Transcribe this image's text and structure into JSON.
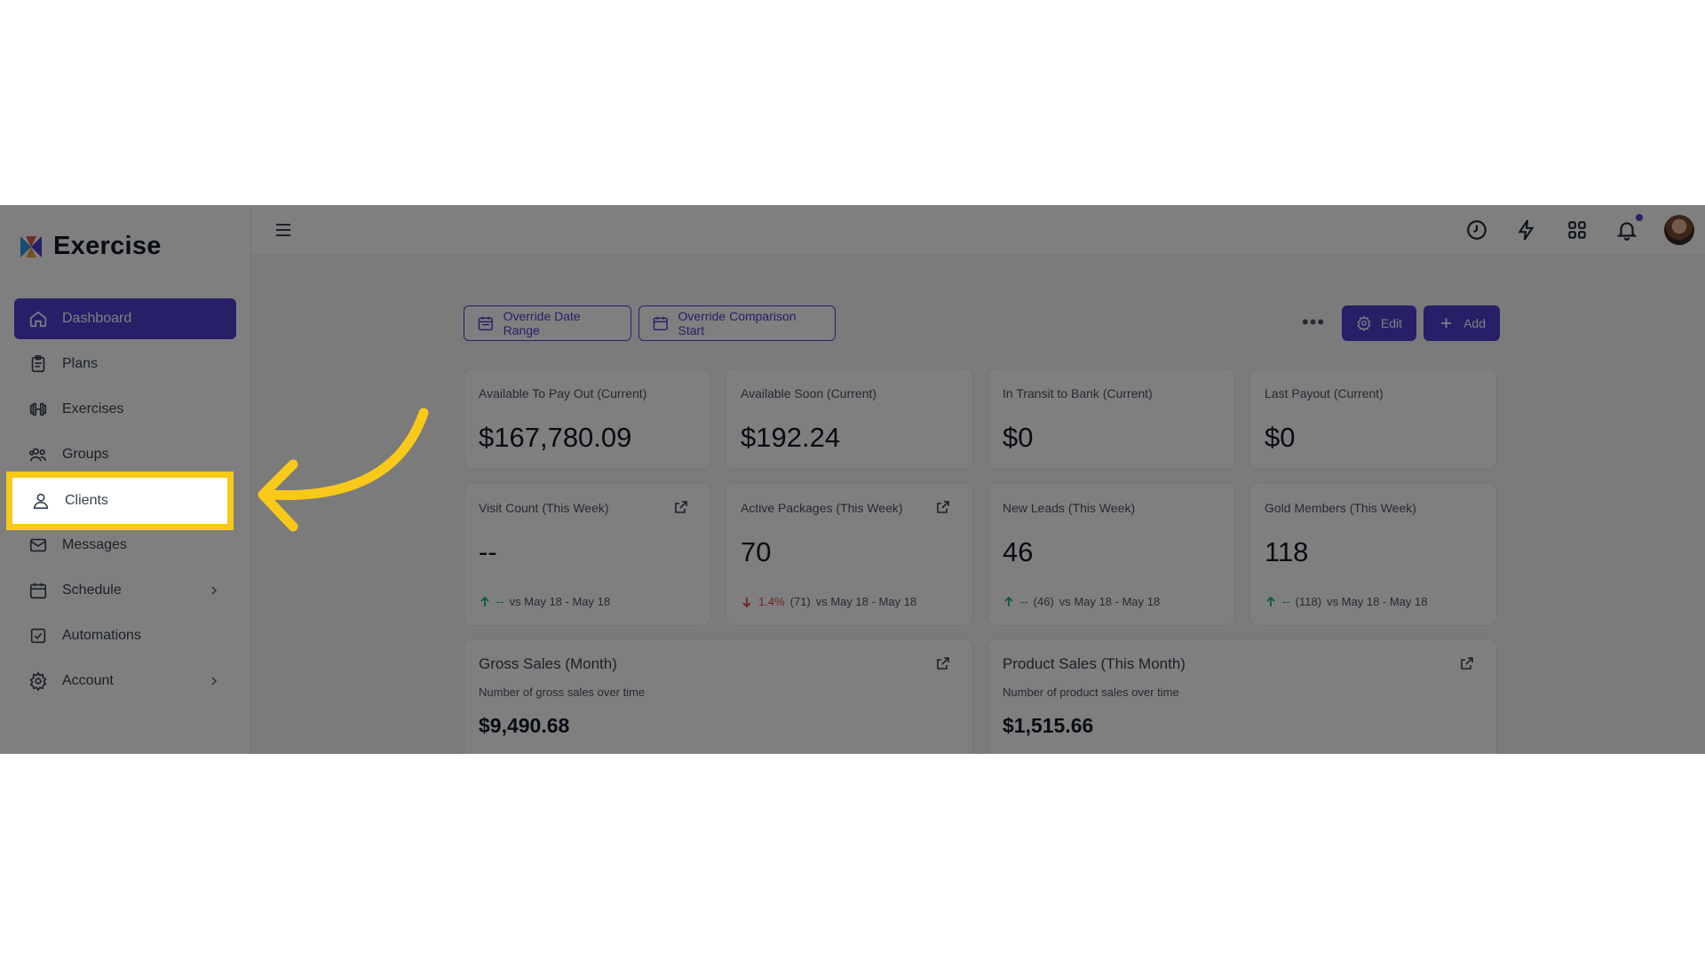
{
  "app": {
    "name": "Exercise"
  },
  "sidebar": {
    "items": [
      {
        "label": "Dashboard",
        "icon": "home-icon",
        "active": true
      },
      {
        "label": "Plans",
        "icon": "clipboard-icon"
      },
      {
        "label": "Exercises",
        "icon": "dumbbell-icon"
      },
      {
        "label": "Groups",
        "icon": "users-icon"
      },
      {
        "label": "Clients",
        "icon": "user-icon",
        "highlighted": true
      },
      {
        "label": "Messages",
        "icon": "mail-icon"
      },
      {
        "label": "Schedule",
        "icon": "calendar-icon",
        "has_submenu": true
      },
      {
        "label": "Automations",
        "icon": "checkbox-icon"
      },
      {
        "label": "Account",
        "icon": "gear-icon",
        "has_submenu": true
      }
    ]
  },
  "topbar": {
    "icons": [
      "menu-icon",
      "clock-icon",
      "bolt-icon",
      "grid-icon",
      "bell-icon",
      "avatar"
    ]
  },
  "actions": {
    "override_date_range": "Override Date Range",
    "override_comparison_start": "Override Comparison Start",
    "edit": "Edit",
    "add": "Add"
  },
  "stats_row1": [
    {
      "label": "Available To Pay Out (Current)",
      "value": "$167,780.09"
    },
    {
      "label": "Available Soon (Current)",
      "value": "$192.24"
    },
    {
      "label": "In Transit to Bank (Current)",
      "value": "$0"
    },
    {
      "label": "Last Payout (Current)",
      "value": "$0"
    }
  ],
  "stats_row2": [
    {
      "label": "Visit Count (This Week)",
      "value": "--",
      "trend": "up",
      "change": "--",
      "prev": "",
      "compare": "vs May 18 - May 18"
    },
    {
      "label": "Active Packages (This Week)",
      "value": "70",
      "trend": "down",
      "change": "1.4%",
      "prev": "(71)",
      "compare": "vs May 18 - May 18"
    },
    {
      "label": "New Leads (This Week)",
      "value": "46",
      "trend": "up",
      "change": "--",
      "prev": "(46)",
      "compare": "vs May 18 - May 18"
    },
    {
      "label": "Gold Members (This Week)",
      "value": "118",
      "trend": "up",
      "change": "--",
      "prev": "(118)",
      "compare": "vs May 18 - May 18"
    }
  ],
  "charts": [
    {
      "title": "Gross Sales (Month)",
      "subtitle": "Number of gross sales over time",
      "value": "$9,490.68"
    },
    {
      "title": "Product Sales (This Month)",
      "subtitle": "Number of product sales over time",
      "value": "$1,515.66"
    }
  ],
  "colors": {
    "brand": "#4f3fd1",
    "highlight": "#f9c919",
    "up": "#10b981",
    "down": "#ef4444"
  }
}
